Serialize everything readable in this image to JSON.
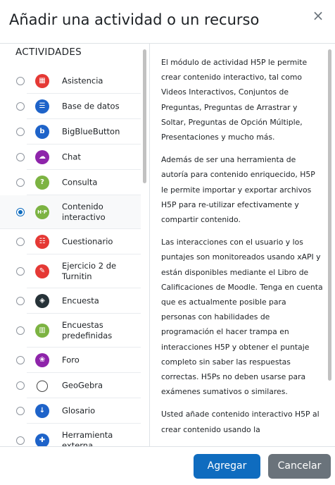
{
  "dialog": {
    "title": "Añadir una actividad o un recurso",
    "close_symbol": "×"
  },
  "sidebar": {
    "section_title": "ACTIVIDADES",
    "items": [
      {
        "label": "Asistencia",
        "icon": "attendance-icon",
        "color": "#e53935",
        "glyph": "▦"
      },
      {
        "label": "Base de datos",
        "icon": "database-icon",
        "color": "#1e63c9",
        "glyph": "☰"
      },
      {
        "label": "BigBlueButton",
        "icon": "bigbluebutton-icon",
        "color": "#1e63c9",
        "glyph": "b"
      },
      {
        "label": "Chat",
        "icon": "chat-icon",
        "color": "#8e24aa",
        "glyph": "☁"
      },
      {
        "label": "Consulta",
        "icon": "choice-icon",
        "color": "#7cb342",
        "glyph": "?"
      },
      {
        "label": "Contenido interactivo",
        "icon": "h5p-icon",
        "color": "#7cb342",
        "glyph": "H·P",
        "selected": true
      },
      {
        "label": "Cuestionario",
        "icon": "quiz-icon",
        "color": "#e53935",
        "glyph": "☷"
      },
      {
        "label": "Ejercicio 2 de Turnitin",
        "icon": "turnitin-icon",
        "color": "#e53935",
        "glyph": "✎"
      },
      {
        "label": "Encuesta",
        "icon": "survey-icon",
        "color": "#263238",
        "glyph": "◈"
      },
      {
        "label": "Encuestas predefinidas",
        "icon": "feedback-icon",
        "color": "#7cb342",
        "glyph": "▥"
      },
      {
        "label": "Foro",
        "icon": "forum-icon",
        "color": "#8e24aa",
        "glyph": "❀"
      },
      {
        "label": "GeoGebra",
        "icon": "geogebra-icon",
        "color": "#ffffff",
        "glyph": "◯"
      },
      {
        "label": "Glosario",
        "icon": "glossary-icon",
        "color": "#1e63c9",
        "glyph": "↓"
      },
      {
        "label": "Herramienta externa",
        "icon": "external-tool-icon",
        "color": "#1e63c9",
        "glyph": "✚"
      }
    ]
  },
  "description": {
    "paragraphs": [
      "El módulo de actividad H5P le permite crear contenido interactivo, tal como Videos Interactivos, Conjuntos de Preguntas, Preguntas de Arrastrar y Soltar, Preguntas de Opción Múltiple, Presentaciones y mucho más.",
      "Además de ser una herramienta de autoría para contenido enriquecido, H5P le permite importar y exportar archivos H5P para re-utilizar efectivamente y compartir contenido.",
      "Las interacciones con el usuario y los puntajes son monitoreados usando xAPI y están disponibles mediante el Libro de Calificaciones de Moodle. Tenga en cuenta que es actualmente posible para personas con habilidades de programación el hacer trampa en interacciones H5P y obtener el puntaje completo sin saber las respuestas correctas. H5Ps no deben usarse para exámenes sumativos o similares.",
      "Usted añade contenido interactivo H5P al crear contenido usando la"
    ]
  },
  "footer": {
    "add_label": "Agregar",
    "cancel_label": "Cancelar"
  }
}
